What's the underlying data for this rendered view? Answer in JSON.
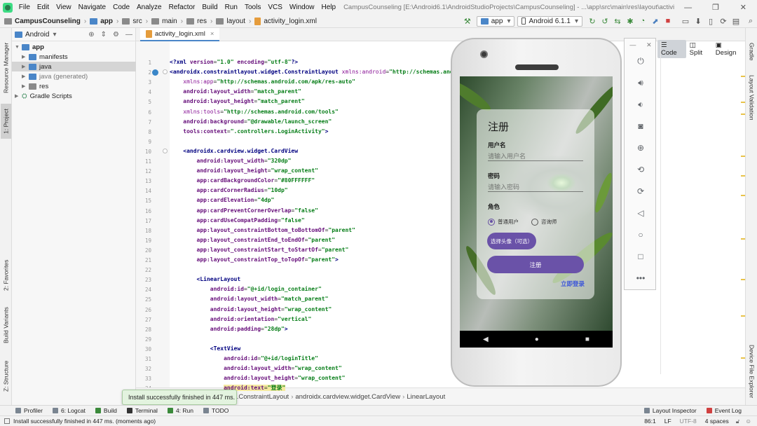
{
  "menu": {
    "items": [
      "File",
      "Edit",
      "View",
      "Navigate",
      "Code",
      "Analyze",
      "Refactor",
      "Build",
      "Run",
      "Tools",
      "VCS",
      "Window",
      "Help"
    ],
    "window_title": "CampusCounseling [E:\\Android6.1\\AndroidStudioProjects\\CampusCounseling] - ...\\app\\src\\main\\res\\layout\\activity_login.xml [app]",
    "minimize": "—",
    "maximize": "❐",
    "close": "✕"
  },
  "navbar": {
    "project": "CampusCounseling",
    "app": "app",
    "src": "src",
    "main": "main",
    "res": "res",
    "layout": "layout",
    "file": "activity_login.xml",
    "run_config": "app",
    "device": "Android 6.1.1"
  },
  "left_strip": {
    "resource_manager": "Resource Manager",
    "project": "1: Project",
    "favorites": "2: Favorites",
    "build_variants": "Build Variants",
    "structure": "Z: Structure"
  },
  "right_strip": {
    "gradle": "Gradle",
    "layout_validation": "Layout Validation",
    "device_file_explorer": "Device File Explorer"
  },
  "project_panel": {
    "view_mode": "Android",
    "tree": [
      {
        "label": "app",
        "bold": true
      },
      {
        "label": "manifests"
      },
      {
        "label": "java"
      },
      {
        "label": "java (generated)"
      },
      {
        "label": "res"
      },
      {
        "label": "Gradle Scripts"
      }
    ]
  },
  "editor": {
    "tab_label": "activity_login.xml",
    "view_modes": {
      "code": "Code",
      "split": "Split",
      "design": "Design"
    },
    "lines": [
      {
        "n": "1",
        "parts": [
          [
            "tg",
            "<?xml "
          ],
          [
            "at",
            "version"
          ],
          [
            "",
            "="
          ],
          [
            "st",
            "\"1.0\""
          ],
          [
            "",
            " "
          ],
          [
            "at",
            "encoding"
          ],
          [
            "",
            "="
          ],
          [
            "st",
            "\"utf-8\""
          ],
          [
            "tg",
            "?>"
          ]
        ]
      },
      {
        "n": "2",
        "parts": [
          [
            "tg",
            "<androidx.constraintlayout.widget.ConstraintLayout "
          ],
          [
            "ns",
            "xmlns:android"
          ],
          [
            "",
            "="
          ],
          [
            "st",
            "\"http://schemas.android.com/apk/res/android\""
          ]
        ]
      },
      {
        "n": "3",
        "parts": [
          [
            "",
            "    "
          ],
          [
            "ns",
            "xmlns:app"
          ],
          [
            "",
            "="
          ],
          [
            "st",
            "\"http://schemas.android.com/apk/res-auto\""
          ]
        ]
      },
      {
        "n": "4",
        "parts": [
          [
            "",
            "    "
          ],
          [
            "at",
            "android:layout_width"
          ],
          [
            "",
            "="
          ],
          [
            "st",
            "\"match_parent\""
          ]
        ]
      },
      {
        "n": "5",
        "parts": [
          [
            "",
            "    "
          ],
          [
            "at",
            "android:layout_height"
          ],
          [
            "",
            "="
          ],
          [
            "st",
            "\"match_parent\""
          ]
        ]
      },
      {
        "n": "6",
        "parts": [
          [
            "",
            "    "
          ],
          [
            "ns",
            "xmlns:tools"
          ],
          [
            "",
            "="
          ],
          [
            "st",
            "\"http://schemas.android.com/tools\""
          ]
        ]
      },
      {
        "n": "7",
        "parts": [
          [
            "",
            "    "
          ],
          [
            "at",
            "android:background"
          ],
          [
            "",
            "="
          ],
          [
            "st",
            "\"@drawable/launch_screen\""
          ]
        ]
      },
      {
        "n": "8",
        "parts": [
          [
            "",
            "    "
          ],
          [
            "at",
            "tools:context"
          ],
          [
            "",
            "="
          ],
          [
            "st",
            "\".controllers.LoginActivity\""
          ],
          [
            "tg",
            ">"
          ]
        ]
      },
      {
        "n": "9",
        "parts": [
          [
            "",
            ""
          ]
        ]
      },
      {
        "n": "10",
        "parts": [
          [
            "",
            "    "
          ],
          [
            "tg",
            "<androidx.cardview.widget.CardView"
          ]
        ]
      },
      {
        "n": "11",
        "parts": [
          [
            "",
            "        "
          ],
          [
            "at",
            "android:layout_width"
          ],
          [
            "",
            "="
          ],
          [
            "st",
            "\"320dp\""
          ]
        ]
      },
      {
        "n": "12",
        "parts": [
          [
            "",
            "        "
          ],
          [
            "at",
            "android:layout_height"
          ],
          [
            "",
            "="
          ],
          [
            "st",
            "\"wrap_content\""
          ]
        ]
      },
      {
        "n": "13",
        "parts": [
          [
            "",
            "        "
          ],
          [
            "at",
            "app:cardBackgroundColor"
          ],
          [
            "",
            "="
          ],
          [
            "st",
            "\"#80FFFFFF\""
          ]
        ]
      },
      {
        "n": "14",
        "parts": [
          [
            "",
            "        "
          ],
          [
            "at",
            "app:cardCornerRadius"
          ],
          [
            "",
            "="
          ],
          [
            "st",
            "\"10dp\""
          ]
        ]
      },
      {
        "n": "15",
        "parts": [
          [
            "",
            "        "
          ],
          [
            "at",
            "app:cardElevation"
          ],
          [
            "",
            "="
          ],
          [
            "st",
            "\"4dp\""
          ]
        ]
      },
      {
        "n": "16",
        "parts": [
          [
            "",
            "        "
          ],
          [
            "at",
            "app:cardPreventCornerOverlap"
          ],
          [
            "",
            "="
          ],
          [
            "st",
            "\"false\""
          ]
        ]
      },
      {
        "n": "17",
        "parts": [
          [
            "",
            "        "
          ],
          [
            "at",
            "app:cardUseCompatPadding"
          ],
          [
            "",
            "="
          ],
          [
            "st",
            "\"false\""
          ]
        ]
      },
      {
        "n": "18",
        "parts": [
          [
            "",
            "        "
          ],
          [
            "at",
            "app:layout_constraintBottom_toBottomOf"
          ],
          [
            "",
            "="
          ],
          [
            "st",
            "\"parent\""
          ]
        ]
      },
      {
        "n": "19",
        "parts": [
          [
            "",
            "        "
          ],
          [
            "at",
            "app:layout_constraintEnd_toEndOf"
          ],
          [
            "",
            "="
          ],
          [
            "st",
            "\"parent\""
          ]
        ]
      },
      {
        "n": "20",
        "parts": [
          [
            "",
            "        "
          ],
          [
            "at",
            "app:layout_constraintStart_toStartOf"
          ],
          [
            "",
            "="
          ],
          [
            "st",
            "\"parent\""
          ]
        ]
      },
      {
        "n": "21",
        "parts": [
          [
            "",
            "        "
          ],
          [
            "at",
            "app:layout_constraintTop_toTopOf"
          ],
          [
            "",
            "="
          ],
          [
            "st",
            "\"parent\""
          ],
          [
            "tg",
            ">"
          ]
        ]
      },
      {
        "n": "22",
        "parts": [
          [
            "",
            ""
          ]
        ]
      },
      {
        "n": "23",
        "parts": [
          [
            "",
            "        "
          ],
          [
            "tg",
            "<LinearLayout"
          ]
        ]
      },
      {
        "n": "24",
        "parts": [
          [
            "",
            "            "
          ],
          [
            "at",
            "android:id"
          ],
          [
            "",
            "="
          ],
          [
            "st",
            "\"@+id/login_container\""
          ]
        ]
      },
      {
        "n": "25",
        "parts": [
          [
            "",
            "            "
          ],
          [
            "at",
            "android:layout_width"
          ],
          [
            "",
            "="
          ],
          [
            "st",
            "\"match_parent\""
          ]
        ]
      },
      {
        "n": "26",
        "parts": [
          [
            "",
            "            "
          ],
          [
            "at",
            "android:layout_height"
          ],
          [
            "",
            "="
          ],
          [
            "st",
            "\"wrap_content\""
          ]
        ]
      },
      {
        "n": "27",
        "parts": [
          [
            "",
            "            "
          ],
          [
            "at",
            "android:orientation"
          ],
          [
            "",
            "="
          ],
          [
            "st",
            "\"vertical\""
          ]
        ]
      },
      {
        "n": "28",
        "parts": [
          [
            "",
            "            "
          ],
          [
            "at",
            "android:padding"
          ],
          [
            "",
            "="
          ],
          [
            "st",
            "\"28dp\""
          ],
          [
            "tg",
            ">"
          ]
        ]
      },
      {
        "n": "29",
        "parts": [
          [
            "",
            ""
          ]
        ]
      },
      {
        "n": "30",
        "parts": [
          [
            "",
            "            "
          ],
          [
            "tg",
            "<TextView"
          ]
        ]
      },
      {
        "n": "31",
        "parts": [
          [
            "",
            "                "
          ],
          [
            "at",
            "android:id"
          ],
          [
            "",
            "="
          ],
          [
            "st",
            "\"@+id/loginTitle\""
          ]
        ]
      },
      {
        "n": "32",
        "parts": [
          [
            "",
            "                "
          ],
          [
            "at",
            "android:layout_width"
          ],
          [
            "",
            "="
          ],
          [
            "st",
            "\"wrap_content\""
          ]
        ]
      },
      {
        "n": "33",
        "parts": [
          [
            "",
            "                "
          ],
          [
            "at",
            "android:layout_height"
          ],
          [
            "",
            "="
          ],
          [
            "st",
            "\"wrap_content\""
          ]
        ]
      },
      {
        "n": "34",
        "parts": [
          [
            "",
            "                "
          ],
          [
            "at hl",
            "android:text"
          ],
          [
            "hl",
            "="
          ],
          [
            "st hl",
            "\"登录\""
          ]
        ]
      }
    ],
    "breadcrumb": [
      "androidx.constraintlayout.widget.ConstraintLayout",
      "androidx.cardview.widget.CardView",
      "LinearLayout"
    ]
  },
  "emulator": {
    "card_title": "注册",
    "username_label": "用户名",
    "username_placeholder": "请输入用户名",
    "password_label": "密码",
    "password_placeholder": "请输入密码",
    "role_label": "角色",
    "role_options": [
      "普通用户",
      "咨询师"
    ],
    "role_selected": "普通用户",
    "avatar_button": "选择头像（可选）",
    "register_button": "注册",
    "login_link": "立即登录",
    "nav": {
      "back": "◀",
      "home": "●",
      "recent": "■"
    }
  },
  "emu_tools": [
    "power-icon",
    "volume-up-icon",
    "volume-down-icon",
    "camera-icon",
    "zoom-icon",
    "rotate-left-icon",
    "rotate-right-icon",
    "back-icon",
    "home-icon",
    "overview-icon",
    "more-icon"
  ],
  "tool_windows": [
    {
      "label": "Profiler"
    },
    {
      "label": "6: Logcat"
    },
    {
      "label": "Build"
    },
    {
      "label": "Terminal"
    },
    {
      "label": "4: Run"
    },
    {
      "label": "TODO"
    }
  ],
  "tool_windows_right": [
    {
      "label": "Layout Inspector"
    },
    {
      "label": "Event Log"
    }
  ],
  "status": {
    "message": "Install successfully finished in 447 ms. (moments ago)",
    "position": "86:1",
    "line_sep": "LF",
    "encoding": "UTF-8",
    "indent": "4 spaces"
  },
  "balloon": "Install successfully finished in 447 ms.",
  "colors": {
    "accent": "#6a52a8",
    "link": "#3b55d9",
    "success_bg": "#e3f3df"
  }
}
